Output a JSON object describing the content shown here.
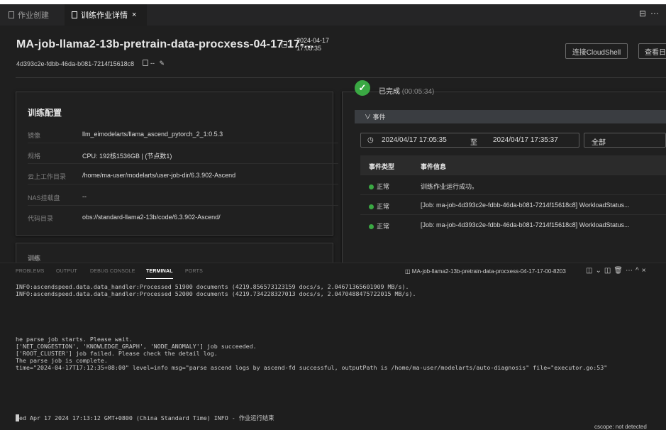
{
  "tabs": [
    {
      "label": "作业创建",
      "active": false
    },
    {
      "label": "训练作业详情",
      "active": true,
      "close": "×"
    }
  ],
  "header": {
    "title": "MA-job-llama2-13b-pretrain-data-procxess-04-17-17-...",
    "date": "2024-04-17",
    "time": "17:05:35",
    "job_id": "4d393c2e-fdbb-46da-b081-7214f15618c8",
    "job_id_extra": "--",
    "buttons": {
      "cloudshell": "连接CloudShell",
      "view_log": "查看日"
    }
  },
  "config": {
    "title": "训练配置",
    "rows": [
      {
        "key": "镜像",
        "value": "llm_eimodelarts/llama_ascend_pytorch_2_1:0.5.3"
      },
      {
        "key": "规格",
        "value": "CPU: 192核1536GB | (节点数1)"
      },
      {
        "key": "云上工作目录",
        "value": "/home/ma-user/modelarts/user-job-dir/6.3.902-Ascend"
      },
      {
        "key": "NAS挂载盘",
        "value": "--"
      },
      {
        "key": "代码目录",
        "value": "obs://standard-llama2-13b/code/6.3.902-Ascend/"
      }
    ],
    "second_panel_title": "训练"
  },
  "status": {
    "label": "已完成",
    "duration": "(00:05:34)",
    "color": "#3aa843"
  },
  "events": {
    "section_label": "∨ 事件",
    "start": "2024/04/17 17:05:35",
    "to": "至",
    "end": "2024/04/17 17:35:37",
    "filter": "全部",
    "headers": [
      "事件类型",
      "事件信息"
    ],
    "rows": [
      {
        "type": "正常",
        "info": "训练作业运行成功。"
      },
      {
        "type": "正常",
        "info": "[Job: ma-job-4d393c2e-fdbb-46da-b081-7214f15618c8] WorkloadStatus..."
      },
      {
        "type": "正常",
        "info": "[Job: ma-job-4d393c2e-fdbb-46da-b081-7214f15618c8] WorkloadStatus..."
      }
    ]
  },
  "panel": {
    "tabs": [
      "PROBLEMS",
      "OUTPUT",
      "DEBUG CONSOLE",
      "TERMINAL",
      "PORTS"
    ],
    "active_tab": "TERMINAL",
    "terminal_name": "MA-job-llama2-13b-pretrain-data-procxess-04-17-17-00-8203"
  },
  "terminal": {
    "lines_top": [
      "INFO:ascendspeed.data.data_handler:Processed 51900 documents (4219.856573123159 docs/s, 2.04671365601909 MB/s).",
      "INFO:ascendspeed.data.data_handler:Processed 52000 documents (4219.734228327013 docs/s, 2.0470488475722015 MB/s)."
    ],
    "lines_mid": [
      "he parse job starts. Please wait.",
      "['NET_CONGESTION', 'KNOWLEDGE_GRAPH', 'NODE_ANOMALY'] job succeeded.",
      "['ROOT_CLUSTER'] job failed. Please check the detail log.",
      "The parse job is complete.",
      "time=\"2024-04-17T17:12:35+08:00\" level=info msg=\"parse ascend logs by ascend-fd successful, outputPath is /home/ma-user/modelarts/auto-diagnosis\" file=\"executor.go:53\""
    ],
    "last_line": "ed Apr 17 2024 17:13:12 GMT+0800 (China Standard Time) INFO - 作业运行结束"
  },
  "statusbar": {
    "text": "cscope: not detected"
  }
}
